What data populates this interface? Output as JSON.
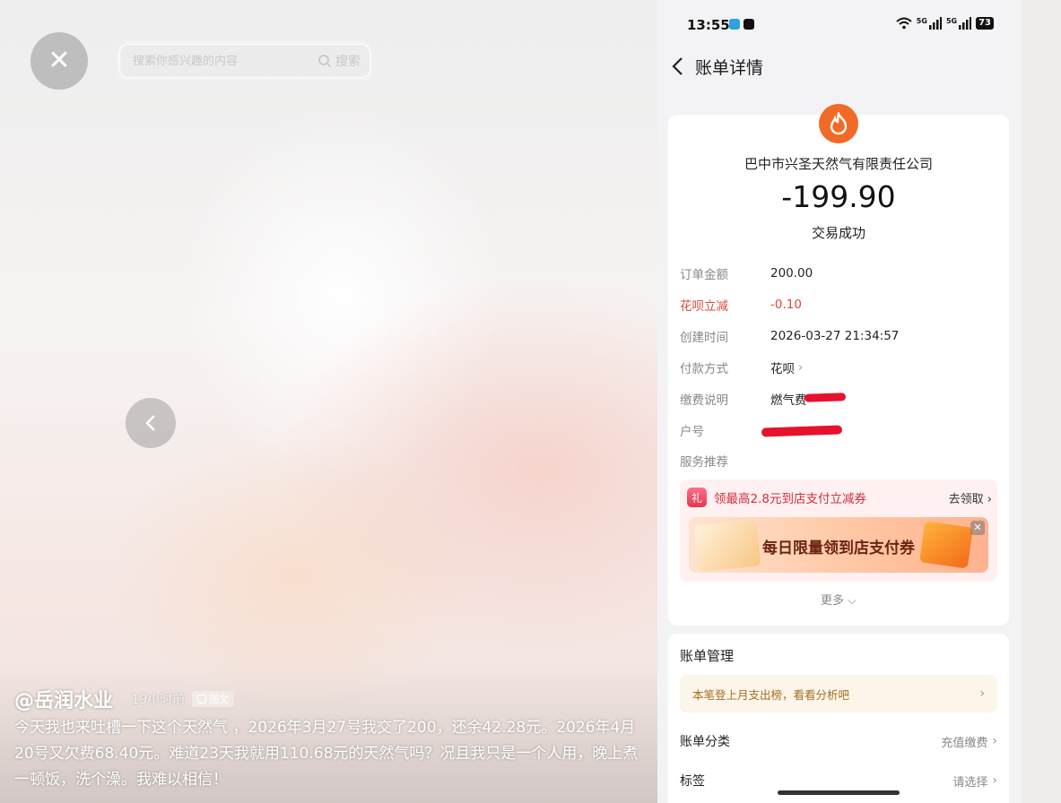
{
  "viewer": {
    "search_placeholder": "搜索你感兴趣的内容",
    "search_button": "搜索"
  },
  "post": {
    "author": "@岳润水业",
    "separator": "·",
    "time": "19小时前",
    "type_tag": "图文",
    "text": "今天我也来吐槽一下这个天然气 ，2026年3月27号我交了200，还余42.28元。2026年4月20号又欠费68.40元。难道23天我就用110.68元的天然气吗？况且我只是一个人用，晚上煮一顿饭，洗个澡。我难以相信！"
  },
  "phone": {
    "status": {
      "time": "13:55",
      "net1": "5G",
      "net2": "5G",
      "battery": "73"
    },
    "nav_title": "账单详情",
    "bill": {
      "merchant": "巴中市兴圣天然气有限责任公司",
      "amount": "-199.90",
      "status": "交易成功",
      "rows": [
        {
          "label": "订单金额",
          "value": "200.00"
        },
        {
          "label": "花呗立减",
          "value": "-0.10"
        },
        {
          "label": "创建时间",
          "value": "2026-03-27 21:34:57"
        },
        {
          "label": "付款方式",
          "value": "花呗"
        },
        {
          "label": "缴费说明",
          "value": "燃气费"
        },
        {
          "label": "户号",
          "value": ""
        },
        {
          "label": "服务推荐",
          "value": ""
        }
      ],
      "promo": {
        "icon_text": "礼",
        "text": "领最高2.8元到店支付立减券",
        "link": "去领取",
        "banner_text": "每日限量领到店支付券"
      },
      "more": "更多"
    },
    "management": {
      "title": "账单管理",
      "insight": "本笔登上月支出榜，看看分析吧",
      "rows": [
        {
          "label": "账单分类",
          "value": "充值缴费"
        },
        {
          "label": "标签",
          "value": "请选择"
        }
      ]
    },
    "colors": {
      "accent_red": "#d9483b",
      "logo_orange": "#f26a28",
      "redaction": "#e8112d"
    }
  }
}
